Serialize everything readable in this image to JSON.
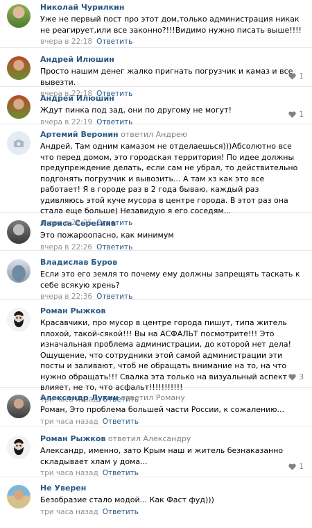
{
  "comments": [
    {
      "author": "Николай Чурилкин",
      "reply_to": "",
      "reply_target": "",
      "text": "Уже не первый пост про этот дом,только администрация никак не реагирует,или все законно?!!!Видимо нужно писать выше!!!!",
      "time": "вчера в 22:18",
      "reply_label": "Ответить",
      "likes": "",
      "avatar_icon": "user-photo"
    },
    {
      "author": "Андрей Илюшин",
      "reply_to": "",
      "reply_target": "",
      "text": "Просто нашим денег жалко пригнать погрузчик и камаз и все вывезти.",
      "time": "вчера в 22:18",
      "reply_label": "Ответить",
      "likes": "1",
      "avatar_icon": "user-photo"
    },
    {
      "author": "Андрей Илюшин",
      "reply_to": "",
      "reply_target": "",
      "text": "Ждут пинка под зад, они по другому не могут!",
      "time": "вчера в 22:19",
      "reply_label": "Ответить",
      "likes": "1",
      "avatar_icon": "user-photo"
    },
    {
      "author": "Артемий Веронин",
      "reply_to": "ответил",
      "reply_target": "Андрею",
      "text": "Андрей, Там одним камазом не отделаешься)))Абсолютно все что перед домом, это городская территория! По идее должны предупреждение делать, если сам не убрал, то действительно подгонять погрузчик и вывозить... А там хз как это все работает! Я в городе раз в 2 года бываю, каждый раз удивляюсь этой куче мусора в центре города. В этот раз она стала еще больше) Незавидую я его соседям...",
      "time": "вчера в 22:25",
      "reply_label": "Ответить",
      "likes": "",
      "avatar_icon": "camera-icon"
    },
    {
      "author": "Лариса Серегина",
      "reply_to": "",
      "reply_target": "",
      "text": "Это пожароопасно, как минимум",
      "time": "вчера в 22:26",
      "reply_label": "Ответить",
      "likes": "",
      "avatar_icon": "user-photo"
    },
    {
      "author": "Владислав Буров",
      "reply_to": "",
      "reply_target": "",
      "text": "Если это его земля то почему ему должны запрещять таскать к себе всякую хрень?",
      "time": "вчера в 22:36",
      "reply_label": "Ответить",
      "likes": "",
      "avatar_icon": "user-photo"
    },
    {
      "author": "Роман Рыжков",
      "reply_to": "",
      "reply_target": "",
      "text": "Красавчики, про мусор в центре города пишут, типа житель плохой, такой-сякой!!! Вы на АСФАЛЬТ посмотрите!!! Это изначальная проблема администрации, до которой нет дела! Ощущение, что сотрудники этой самой администрации эти посты и заливают, чтоб не обращать внимание на то, на что нужно обращать!!! Свалка эта только на визуальный аспект влияет, не то, что асфальт!!!!!!!!!!!",
      "time": "три часа назад",
      "reply_label": "Ответить",
      "likes": "3",
      "avatar_icon": "user-photo"
    },
    {
      "author": "Александр Лукин",
      "reply_to": "ответил",
      "reply_target": "Роману",
      "text": "Роман, Это проблема большей части России, к сожалению...",
      "time": "три часа назад",
      "reply_label": "Ответить",
      "likes": "",
      "avatar_icon": "user-photo"
    },
    {
      "author": "Роман Рыжков",
      "reply_to": "ответил",
      "reply_target": "Александру",
      "text": "Александр, именно, зато Крым наш и житель безнаказанно складывает хлам у дома...",
      "time": "три часа назад",
      "reply_label": "Ответить",
      "likes": "1",
      "avatar_icon": "user-photo"
    },
    {
      "author": "Не Уверен",
      "reply_to": "",
      "reply_target": "",
      "text": "Безобразие стало модой... Как Фаст фуд)))",
      "time": "три часа назад",
      "reply_label": "Ответить",
      "likes": "",
      "avatar_icon": "user-photo"
    }
  ],
  "colors": {
    "author": "#2a5885",
    "meta": "#939393",
    "divider": "#e7e8ec",
    "heart": "#828282"
  }
}
